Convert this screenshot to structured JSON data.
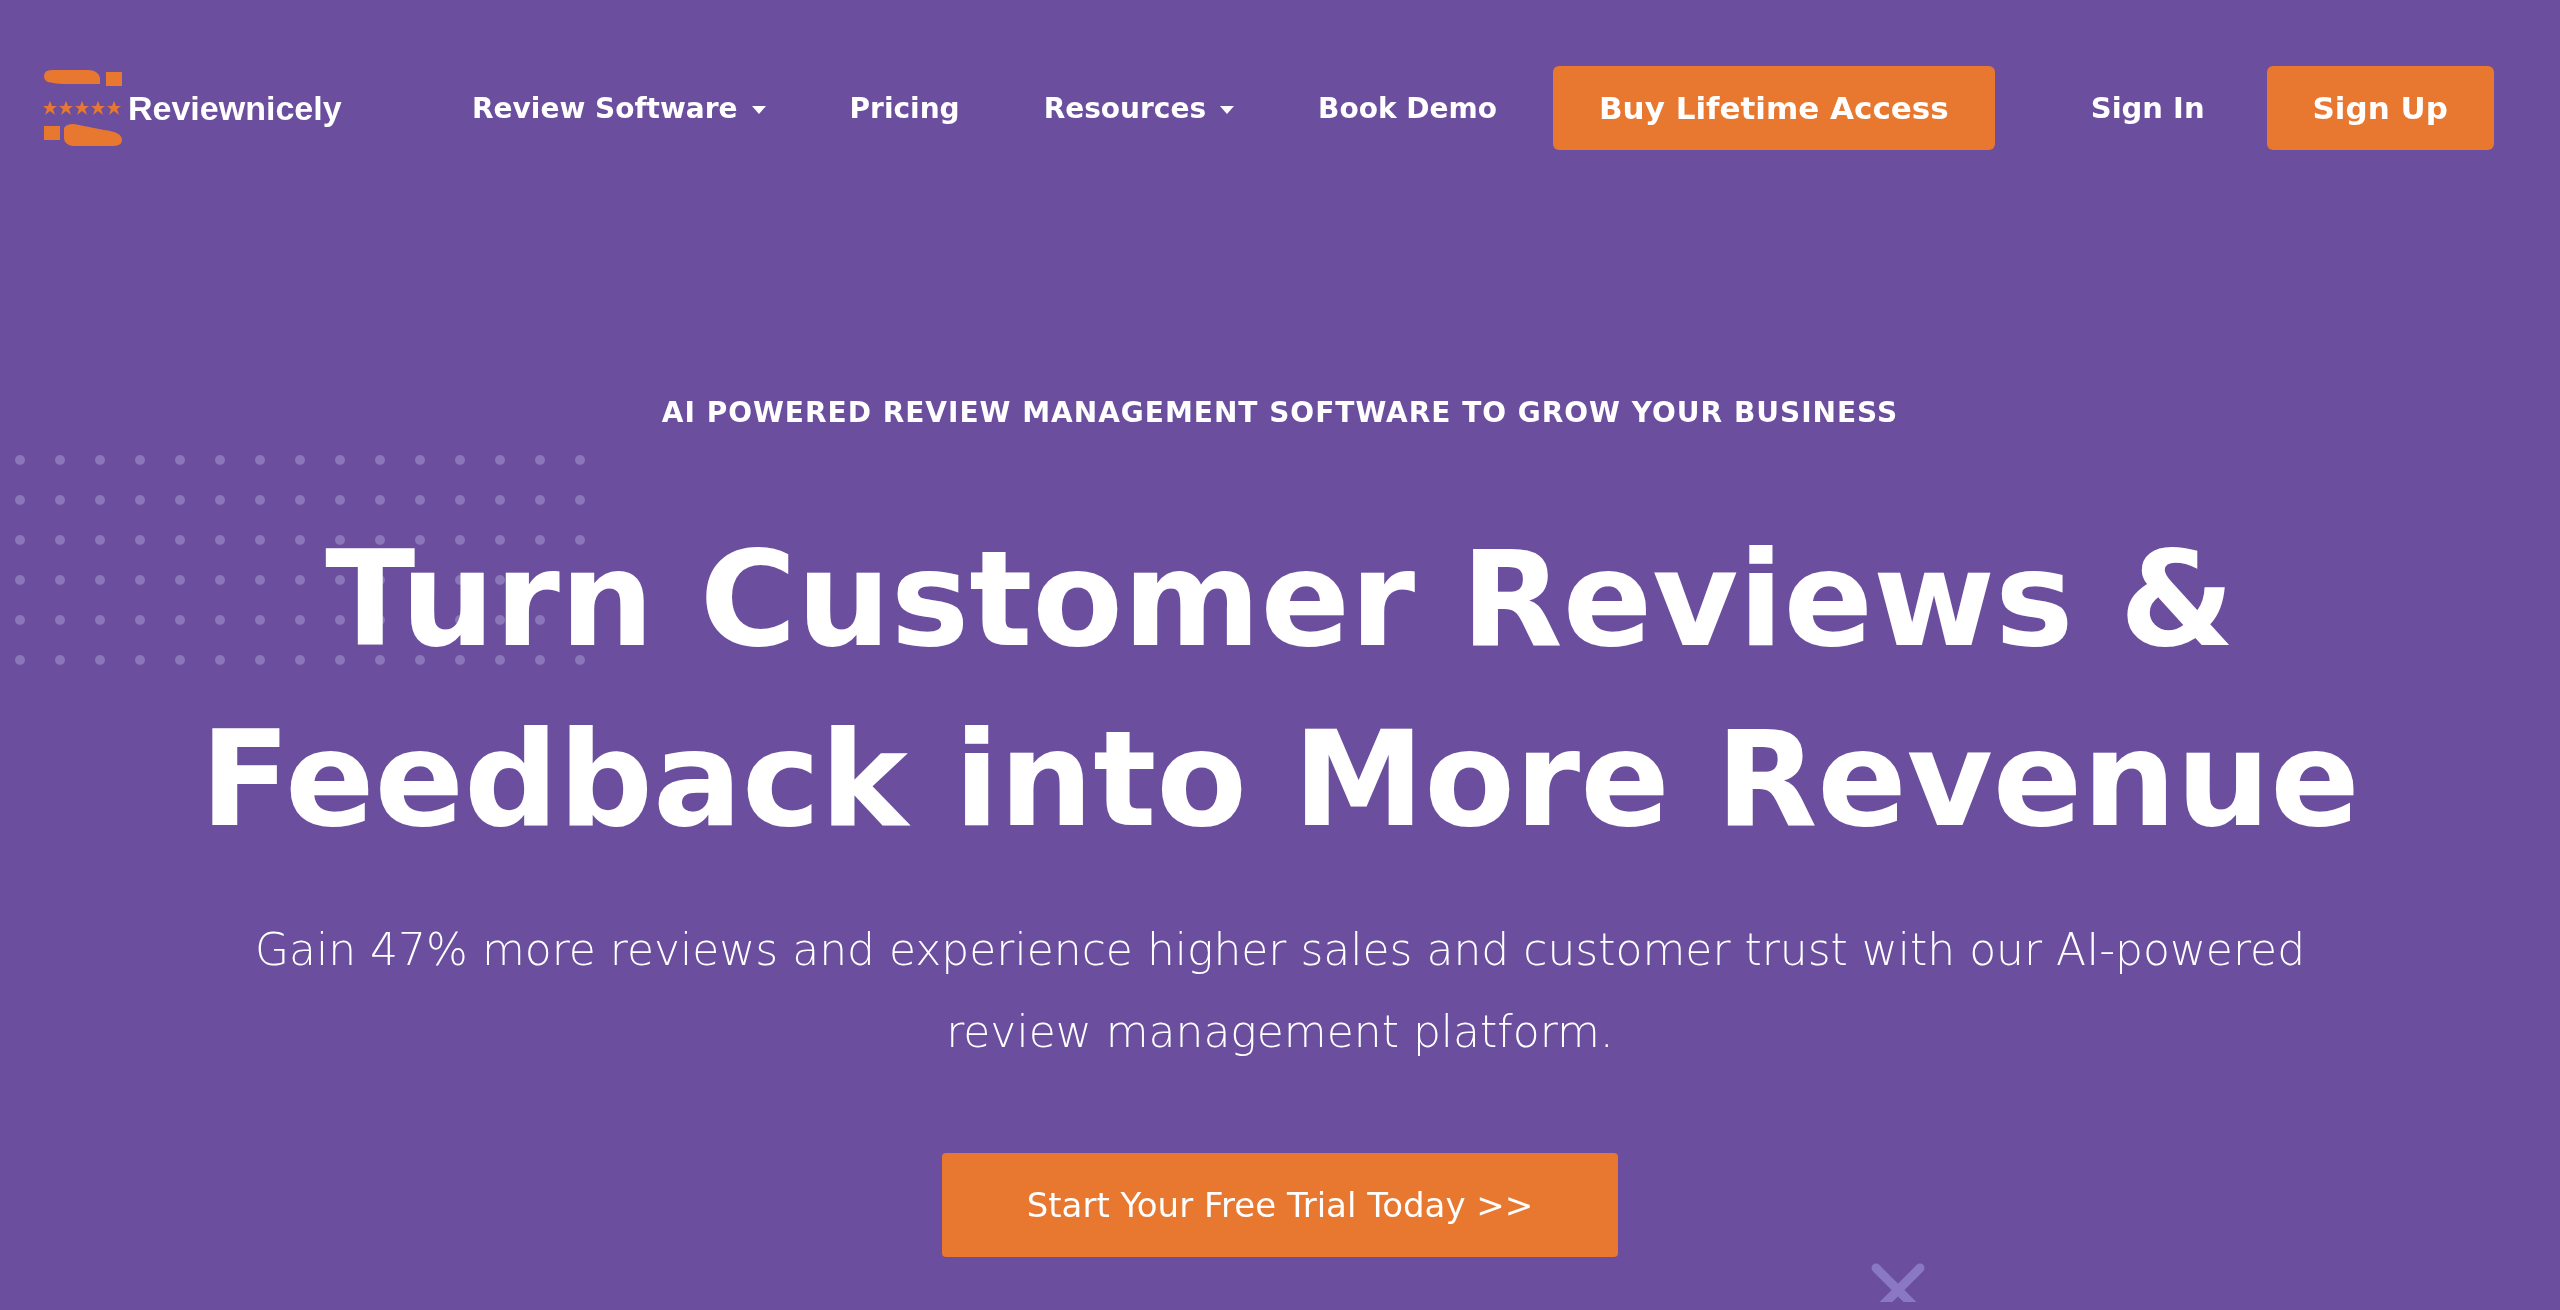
{
  "logo": {
    "text": "Reviewnicely"
  },
  "nav": [
    {
      "label": "Review Software",
      "kind": "dropdown"
    },
    {
      "label": "Pricing",
      "kind": "link"
    },
    {
      "label": "Resources",
      "kind": "dropdown"
    },
    {
      "label": "Book Demo",
      "kind": "link"
    }
  ],
  "actions": [
    {
      "label": "Buy Lifetime Access",
      "kind": "primary"
    },
    {
      "label": "Sign In",
      "kind": "plain"
    },
    {
      "label": "Sign Up",
      "kind": "primary"
    }
  ],
  "hero": {
    "kicker": "AI POWERED REVIEW MANAGEMENT SOFTWARE TO GROW YOUR BUSINESS",
    "headline": [
      "Turn Customer Reviews &",
      "Feedback into More Revenue"
    ],
    "subtitle": "Gain 47% more reviews and experience higher sales and customer trust with our AI-powered review management platform.",
    "cta": "Start Your Free Trial Today >>"
  }
}
